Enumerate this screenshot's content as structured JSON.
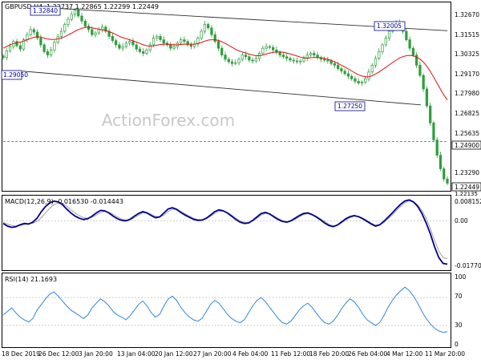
{
  "price_panel": {
    "symbol_label": "GBPUSD,H4",
    "ohlc": "1.22737 1.22865 1.22299 1.22449",
    "y_ticks": [
      "1.32670",
      "1.31515",
      "1.30325",
      "1.29170",
      "1.27980",
      "1.26825",
      "1.25635",
      "1.23290"
    ],
    "price_tag_current": "1.22449",
    "price_tag_level": "1.24900",
    "price_tag_low": "1.22135",
    "annotations": [
      "1.32840",
      "1.32005",
      "1.27250",
      "1.29050"
    ],
    "watermark": "ActionForex.com"
  },
  "macd_panel": {
    "label": "MACD(12,26,9) -0.016530 -0.014443",
    "y_ticks": [
      "0.008152",
      "0.00",
      "-0.017705"
    ]
  },
  "rsi_panel": {
    "label": "RSI(14) 21.1693",
    "y_ticks": [
      "100",
      "70",
      "30",
      "0"
    ]
  },
  "x_ticks": [
    "18 Dec 2019",
    "26 Dec 12:00",
    "3 Jan 20:00",
    "13 Jan 04:00",
    "20 Jan 12:00",
    "27 Jan 20:00",
    "4 Feb 04:00",
    "11 Feb 12:00",
    "18 Feb 20:00",
    "26 Feb 04:00",
    "4 Mar 12:00",
    "11 Mar 20:00"
  ],
  "colors": {
    "candles": "#2f9e3c",
    "ma": "#e01010",
    "channel": "#303030",
    "macd": "#00008b",
    "signal": "#a0a0a0",
    "rsi": "#2e86de",
    "level_line": "#606060",
    "watermark": "#c8c8c8"
  },
  "chart_data": [
    {
      "type": "line",
      "subtype": "candlestick",
      "symbol": "GBPUSD",
      "ylim": [
        1.22,
        1.331
      ],
      "close": [
        1.2985,
        1.3025,
        1.305,
        1.308,
        1.3055,
        1.3035,
        1.309,
        1.312,
        1.315,
        1.3135,
        1.31,
        1.306,
        1.302,
        1.3,
        1.303,
        1.3075,
        1.311,
        1.314,
        1.318,
        1.321,
        1.324,
        1.3265,
        1.323,
        1.32,
        1.317,
        1.315,
        1.312,
        1.313,
        1.315,
        1.3165,
        1.314,
        1.311,
        1.3085,
        1.306,
        1.304,
        1.305,
        1.307,
        1.308,
        1.306,
        1.3035,
        1.302,
        1.301,
        1.303,
        1.306,
        1.31,
        1.311,
        1.309,
        1.307,
        1.306,
        1.304,
        1.305,
        1.307,
        1.309,
        1.308,
        1.306,
        1.305,
        1.3065,
        1.31,
        1.314,
        1.318,
        1.316,
        1.312,
        1.308,
        1.304,
        1.3,
        1.2975,
        1.296,
        1.295,
        1.2955,
        1.2975,
        1.3,
        1.299,
        1.297,
        1.2965,
        1.298,
        1.301,
        1.304,
        1.305,
        1.3045,
        1.303,
        1.3015,
        1.3,
        1.299,
        1.298,
        1.297,
        1.2965,
        1.296,
        1.2965,
        1.298,
        1.3,
        1.301,
        1.3,
        1.2985,
        1.2975,
        1.297,
        1.2965,
        1.295,
        1.294,
        1.292,
        1.2905,
        1.289,
        1.2875,
        1.286,
        1.2845,
        1.2835,
        1.284,
        1.286,
        1.29,
        1.294,
        1.298,
        1.302,
        1.306,
        1.31,
        1.314,
        1.317,
        1.319,
        1.318,
        1.314,
        1.309,
        1.304,
        1.3,
        1.294,
        1.288,
        1.28,
        1.27,
        1.26,
        1.25,
        1.241,
        1.233,
        1.227,
        1.2245
      ],
      "moving_average": [
        1.304,
        1.305,
        1.306,
        1.3068,
        1.3072,
        1.3076,
        1.3082,
        1.309,
        1.3098,
        1.3105,
        1.3108,
        1.3106,
        1.31,
        1.3095,
        1.3092,
        1.3092,
        1.3095,
        1.31,
        1.3108,
        1.3118,
        1.3128,
        1.314,
        1.315,
        1.3158,
        1.3162,
        1.3164,
        1.316,
        1.3156,
        1.3152,
        1.3148,
        1.3144,
        1.3138,
        1.313,
        1.312,
        1.311,
        1.3102,
        1.3096,
        1.309,
        1.3084,
        1.3076,
        1.3068,
        1.306,
        1.3055,
        1.3052,
        1.3054,
        1.3058,
        1.3062,
        1.3064,
        1.3064,
        1.3062,
        1.306,
        1.306,
        1.3062,
        1.3064,
        1.3064,
        1.3064,
        1.3064,
        1.3068,
        1.3074,
        1.3082,
        1.3088,
        1.309,
        1.309,
        1.3086,
        1.3078,
        1.3068,
        1.3058,
        1.3046,
        1.3034,
        1.3024,
        1.3018,
        1.3012,
        1.3006,
        1.3,
        1.2996,
        1.2996,
        1.3,
        1.3006,
        1.3012,
        1.3016,
        1.3018,
        1.3018,
        1.3016,
        1.3012,
        1.3006,
        1.3,
        1.2994,
        1.2988,
        1.2984,
        1.2982,
        1.2984,
        1.2986,
        1.2986,
        1.2984,
        1.298,
        1.2975,
        1.2968,
        1.296,
        1.295,
        1.294,
        1.293,
        1.2918,
        1.2906,
        1.2894,
        1.2884,
        1.2876,
        1.2872,
        1.2872,
        1.2878,
        1.2888,
        1.29,
        1.2914,
        1.2928,
        1.2942,
        1.2956,
        1.297,
        1.2982,
        1.299,
        1.2996,
        1.2998,
        1.2996,
        1.2988,
        1.2976,
        1.2958,
        1.2934,
        1.2904,
        1.287,
        1.2834,
        1.2798,
        1.2764,
        1.2735
      ],
      "channel_upper": {
        "x": [
          "26 Dec 12:00",
          "11 Mar 20:00"
        ],
        "y": [
          1.3284,
          1.32
        ]
      },
      "channel_lower": {
        "x": [
          "18 Dec 2019",
          "11 Mar 20:00"
        ],
        "y": [
          1.2905,
          1.2725
        ]
      },
      "level_line": 1.249
    },
    {
      "type": "line",
      "ylim": [
        -0.0185,
        0.009
      ],
      "series": [
        {
          "values": [
            -0.001,
            -0.002,
            -0.0025,
            -0.0022,
            -0.0015,
            -0.001,
            -0.0012,
            -0.0005,
            0.001,
            0.0035,
            0.0055,
            0.0068,
            0.0075,
            0.0072,
            0.0062,
            0.0045,
            0.003,
            0.0018,
            0.001,
            0.0005,
            0.0008,
            0.0018,
            0.003,
            0.004,
            0.0038,
            0.003,
            0.0018,
            0.0008,
            0.0002,
            0.0,
            0.0006,
            0.0018,
            0.0028,
            0.0035,
            0.003,
            0.002,
            0.0012,
            0.0015,
            0.003,
            0.0045,
            0.005,
            0.0044,
            0.0032,
            0.0022,
            0.0014,
            0.0006,
            0.0002,
            0.0003,
            0.001,
            0.0022,
            0.0035,
            0.0042,
            0.0038,
            0.003,
            0.0018,
            0.0005,
            -0.0005,
            -0.001,
            -0.0008,
            0.0002,
            0.0015,
            0.0028,
            0.0032,
            0.0026,
            0.0015,
            0.0005,
            -0.0002,
            -0.0005,
            0.0,
            0.001,
            0.002,
            0.0028,
            0.003,
            0.0024,
            0.0015,
            0.0004,
            -0.0008,
            -0.0018,
            -0.0022,
            -0.0016,
            -0.0004,
            0.0008,
            0.0016,
            0.002,
            0.0016,
            0.0008,
            -0.0002,
            -0.0012,
            -0.002,
            -0.0015,
            -0.0002,
            0.0014,
            0.003,
            0.0048,
            0.0064,
            0.0076,
            0.008,
            0.0072,
            0.0055,
            0.0028,
            -0.0008,
            -0.005,
            -0.01,
            -0.014,
            -0.0162,
            -0.0165
          ]
        },
        {
          "values": [
            -0.0005,
            -0.0012,
            -0.0018,
            -0.002,
            -0.0018,
            -0.0014,
            -0.0012,
            -0.0009,
            -0.0002,
            0.0012,
            0.003,
            0.0048,
            0.0062,
            0.0068,
            0.0066,
            0.0056,
            0.0042,
            0.003,
            0.002,
            0.0012,
            0.001,
            0.0014,
            0.0022,
            0.0032,
            0.0036,
            0.0033,
            0.0025,
            0.0015,
            0.0007,
            0.0003,
            0.0004,
            0.0012,
            0.0022,
            0.003,
            0.0031,
            0.0025,
            0.0017,
            0.0015,
            0.0022,
            0.0035,
            0.0044,
            0.0044,
            0.0036,
            0.0027,
            0.0018,
            0.001,
            0.0005,
            0.0004,
            0.0008,
            0.0017,
            0.0028,
            0.0036,
            0.0037,
            0.0032,
            0.0022,
            0.001,
            0.0,
            -0.0006,
            -0.0006,
            0.0,
            0.001,
            0.0022,
            0.0029,
            0.0027,
            0.0019,
            0.0009,
            0.0001,
            -0.0003,
            -0.0001,
            0.0006,
            0.0015,
            0.0024,
            0.0028,
            0.0025,
            0.0018,
            0.0008,
            -0.0003,
            -0.0013,
            -0.0019,
            -0.0017,
            -0.0008,
            0.0003,
            0.0012,
            0.0018,
            0.0017,
            0.0011,
            0.0002,
            -0.0008,
            -0.0016,
            -0.0015,
            -0.0006,
            0.0008,
            0.0022,
            0.004,
            0.0056,
            0.0069,
            0.0076,
            0.0073,
            0.0061,
            0.004,
            0.001,
            -0.003,
            -0.0075,
            -0.0115,
            -0.014,
            -0.0144
          ]
        }
      ]
    },
    {
      "type": "line",
      "ylim": [
        0,
        100
      ],
      "series": [
        {
          "values": [
            45,
            50,
            55,
            48,
            42,
            38,
            35,
            40,
            52,
            60,
            68,
            75,
            78,
            72,
            65,
            58,
            52,
            48,
            44,
            40,
            45,
            55,
            62,
            68,
            64,
            58,
            50,
            45,
            42,
            38,
            44,
            52,
            60,
            65,
            58,
            48,
            42,
            46,
            58,
            68,
            72,
            66,
            56,
            48,
            42,
            38,
            36,
            40,
            50,
            60,
            66,
            62,
            54,
            46,
            40,
            36,
            34,
            38,
            48,
            58,
            66,
            70,
            64,
            56,
            48,
            40,
            34,
            32,
            36,
            44,
            52,
            58,
            62,
            56,
            48,
            40,
            34,
            32,
            36,
            44,
            54,
            62,
            68,
            64,
            56,
            46,
            38,
            34,
            30,
            34,
            44,
            56,
            66,
            74,
            80,
            85,
            80,
            72,
            62,
            50,
            40,
            32,
            26,
            22,
            20,
            21
          ]
        }
      ]
    }
  ]
}
